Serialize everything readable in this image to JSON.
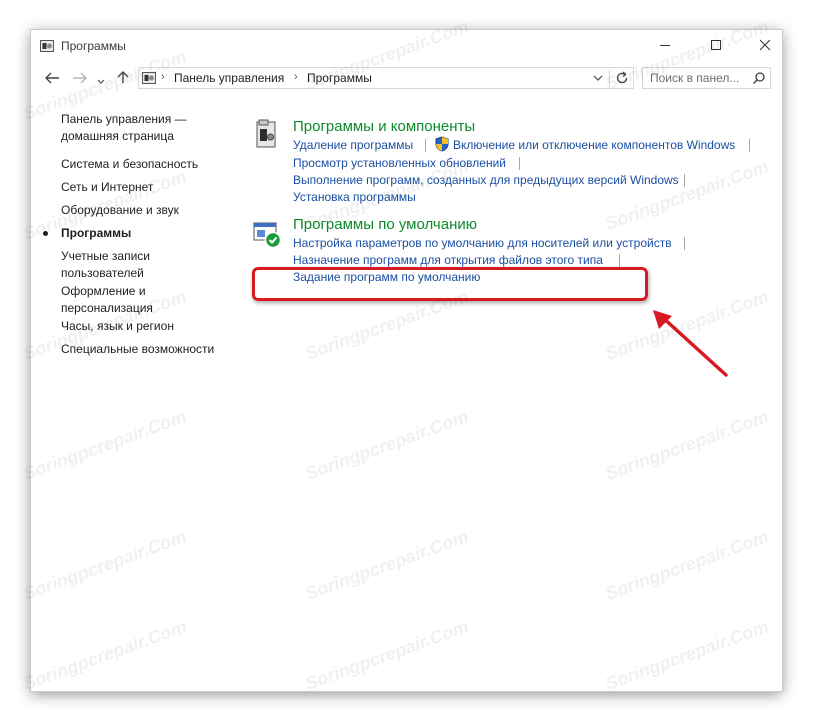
{
  "window": {
    "title": "Программы"
  },
  "address": {
    "crumbs": [
      "Панель управления",
      "Программы"
    ]
  },
  "search": {
    "placeholder": "Поиск в панел..."
  },
  "sidebar": {
    "items": [
      {
        "label": "Панель управления — домашняя страница"
      },
      {
        "label": "Система и безопасность"
      },
      {
        "label": "Сеть и Интернет"
      },
      {
        "label": "Оборудование и звук"
      },
      {
        "label": "Программы",
        "current": true
      },
      {
        "label": "Учетные записи пользователей"
      },
      {
        "label": "Оформление и персонализация"
      },
      {
        "label": "Часы, язык и регион"
      },
      {
        "label": "Специальные возможности"
      }
    ]
  },
  "categories": [
    {
      "title": "Программы и компоненты",
      "links": [
        "Удаление программы",
        "Включение или отключение компонентов Windows",
        "Просмотр установленных обновлений",
        "Выполнение программ, созданных для предыдущих версий Windows",
        "Установка программы"
      ]
    },
    {
      "title": "Программы по умолчанию",
      "links": [
        "Настройка параметров по умолчанию для носителей или устройств",
        "Назначение программ для открытия файлов этого типа",
        "Задание программ по умолчанию"
      ]
    }
  ],
  "watermark": "Soringpcrepair.Com",
  "colors": {
    "category_title": "#0c8a2c",
    "link": "#1a4fa3",
    "annotation": "#d71921"
  }
}
